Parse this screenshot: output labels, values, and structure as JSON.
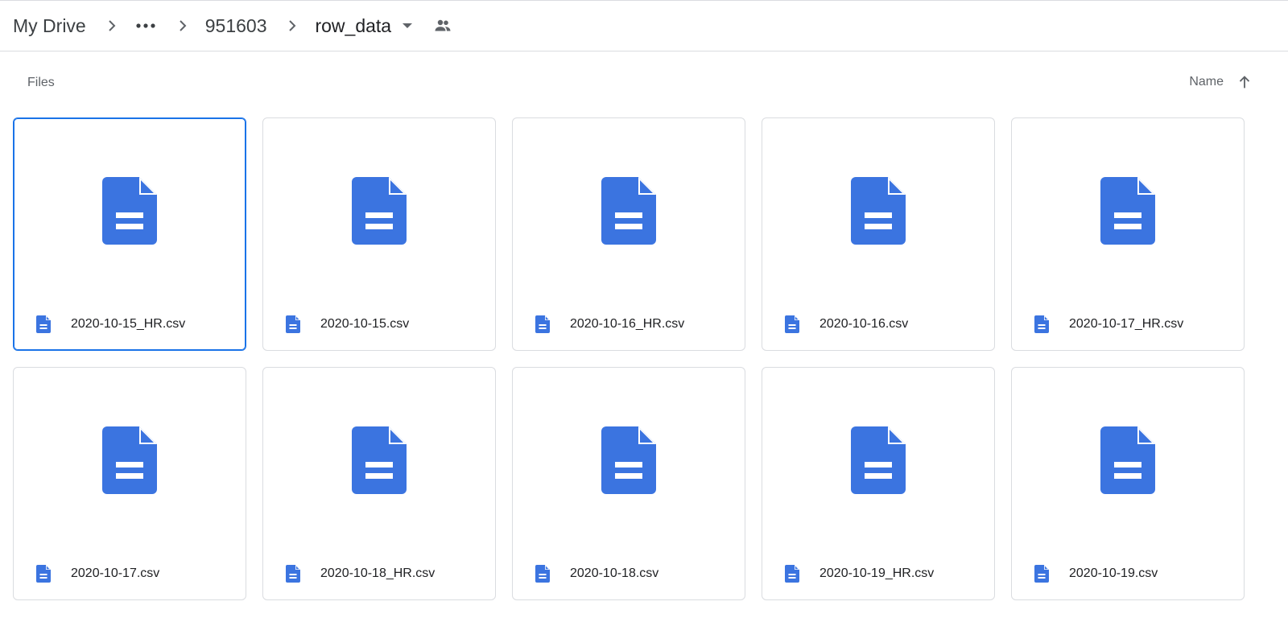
{
  "breadcrumb": {
    "root": "My Drive",
    "middle": "951603",
    "current": "row_data"
  },
  "section": {
    "label": "Files"
  },
  "sort": {
    "label": "Name",
    "direction": "ascending"
  },
  "colors": {
    "doc_blue": "#3b74e0",
    "selected_border": "#1a73e8"
  },
  "files": [
    {
      "name": "2020-10-15_HR.csv",
      "selected": true
    },
    {
      "name": "2020-10-15.csv",
      "selected": false
    },
    {
      "name": "2020-10-16_HR.csv",
      "selected": false
    },
    {
      "name": "2020-10-16.csv",
      "selected": false
    },
    {
      "name": "2020-10-17_HR.csv",
      "selected": false
    },
    {
      "name": "2020-10-17.csv",
      "selected": false
    },
    {
      "name": "2020-10-18_HR.csv",
      "selected": false
    },
    {
      "name": "2020-10-18.csv",
      "selected": false
    },
    {
      "name": "2020-10-19_HR.csv",
      "selected": false
    },
    {
      "name": "2020-10-19.csv",
      "selected": false
    }
  ]
}
